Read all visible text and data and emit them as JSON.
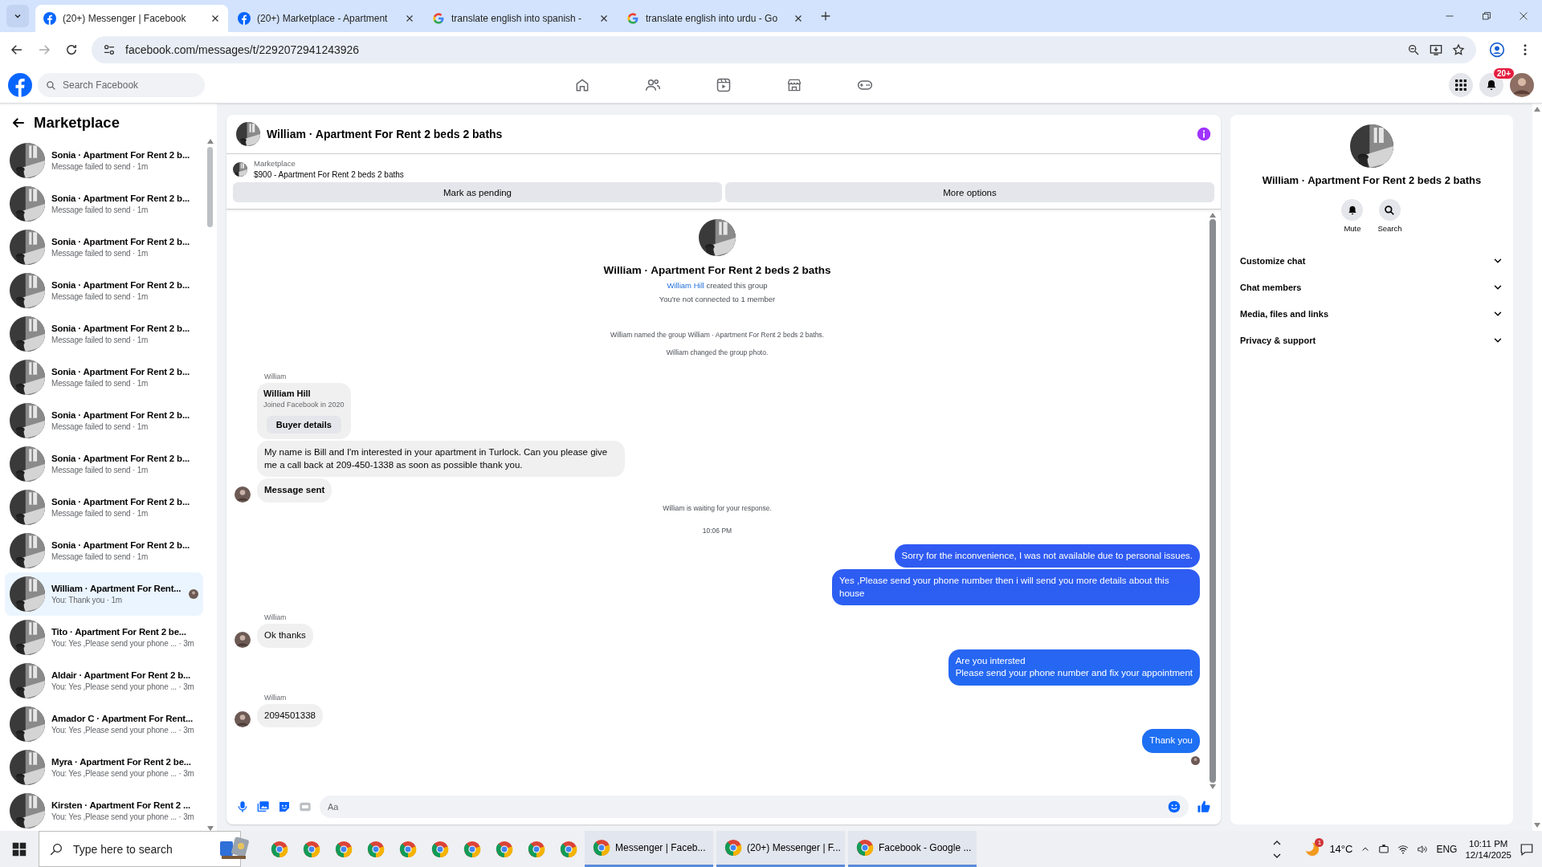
{
  "browser": {
    "tabs": [
      {
        "title": "(20+) Messenger | Facebook",
        "kind": "facebook",
        "selected": true
      },
      {
        "title": "(20+) Marketplace - Apartment",
        "kind": "facebook",
        "selected": false
      },
      {
        "title": "translate english into spanish -",
        "kind": "google",
        "selected": false
      },
      {
        "title": "translate english into urdu - Go",
        "kind": "google",
        "selected": false
      }
    ],
    "url": "facebook.com/messages/t/2292072941243926"
  },
  "facebook_header": {
    "search": {
      "placeholder": "Search Facebook"
    },
    "notification_badge": "20+"
  },
  "sidebar": {
    "title": "Marketplace",
    "conversations": [
      {
        "name": "Sonia · Apartment For Rent 2 b...",
        "preview": "Message failed to send · 1m",
        "selected": false,
        "seen": false
      },
      {
        "name": "Sonia · Apartment For Rent 2 b...",
        "preview": "Message failed to send · 1m",
        "selected": false,
        "seen": false
      },
      {
        "name": "Sonia · Apartment For Rent 2 b...",
        "preview": "Message failed to send · 1m",
        "selected": false,
        "seen": false
      },
      {
        "name": "Sonia · Apartment For Rent 2 b...",
        "preview": "Message failed to send · 1m",
        "selected": false,
        "seen": false
      },
      {
        "name": "Sonia · Apartment For Rent 2 b...",
        "preview": "Message failed to send · 1m",
        "selected": false,
        "seen": false
      },
      {
        "name": "Sonia · Apartment For Rent 2 b...",
        "preview": "Message failed to send · 1m",
        "selected": false,
        "seen": false
      },
      {
        "name": "Sonia · Apartment For Rent 2 b...",
        "preview": "Message failed to send · 1m",
        "selected": false,
        "seen": false
      },
      {
        "name": "Sonia · Apartment For Rent 2 b...",
        "preview": "Message failed to send · 1m",
        "selected": false,
        "seen": false
      },
      {
        "name": "Sonia · Apartment For Rent 2 b...",
        "preview": "Message failed to send · 1m",
        "selected": false,
        "seen": false
      },
      {
        "name": "Sonia · Apartment For Rent 2 b...",
        "preview": "Message failed to send · 1m",
        "selected": false,
        "seen": false
      },
      {
        "name": "William · Apartment For Rent...",
        "preview": "You: Thank you · 1m",
        "selected": true,
        "seen": true
      },
      {
        "name": "Tito · Apartment For Rent 2 be...",
        "preview": "You: Yes ,Please send your phone ... · 3m",
        "selected": false,
        "seen": false
      },
      {
        "name": "Aldair · Apartment For Rent 2 b...",
        "preview": "You: Yes ,Please send your phone ... · 3m",
        "selected": false,
        "seen": false
      },
      {
        "name": "Amador C · Apartment For Rent...",
        "preview": "You: Yes ,Please send your phone ... · 3m",
        "selected": false,
        "seen": false
      },
      {
        "name": "Myra · Apartment For Rent 2 be...",
        "preview": "You: Yes ,Please send your phone ... · 3m",
        "selected": false,
        "seen": false
      },
      {
        "name": "Kirsten · Apartment For Rent 2 ...",
        "preview": "You: Yes ,Please send your phone ... · 3m",
        "selected": false,
        "seen": false
      }
    ]
  },
  "chat": {
    "title": "William · Apartment For Rent 2 beds 2 baths",
    "listing": {
      "label": "Marketplace",
      "title": "$900 - Apartment For Rent 2 beds 2 baths"
    },
    "buttons": [
      "Mark as pending",
      "More options"
    ],
    "intro": {
      "title": "William · Apartment For Rent 2 beds 2 baths",
      "creator": "William Hill",
      "created_text": "created this group",
      "connection": "You're not connected to 1 member"
    },
    "messages": [
      {
        "kind": "event",
        "text": "William named the group William · Apartment For Rent 2 beds 2 baths."
      },
      {
        "kind": "event",
        "text": "William changed the group photo."
      },
      {
        "kind": "sender",
        "text": "William"
      },
      {
        "kind": "profile_card",
        "name": "William Hill",
        "subtitle": "Joined Facebook in 2020",
        "button": "Buyer details"
      },
      {
        "kind": "incoming",
        "text": "My name is Bill and I'm interested in your apartment in Turlock. Can you please give me a call back at 209-450-1338 as soon as possible thank you.",
        "avatar": false
      },
      {
        "kind": "status",
        "text": "Message sent",
        "avatar": true
      },
      {
        "kind": "event",
        "text": "William is waiting for your response."
      },
      {
        "kind": "time",
        "text": "10:06 PM"
      },
      {
        "kind": "outgoing",
        "text": "Sorry for the inconvenience, I was not available due to personal issues."
      },
      {
        "kind": "outgoing",
        "text": "Yes ,Please send your phone number then i will send you more details about this house"
      },
      {
        "kind": "sender",
        "text": "William"
      },
      {
        "kind": "incoming",
        "text": "Ok thanks",
        "avatar": true
      },
      {
        "kind": "outgoing",
        "text": "Are you intersted\nPlease send your phone number and fix your appointment"
      },
      {
        "kind": "sender",
        "text": "William"
      },
      {
        "kind": "incoming",
        "text": "2094501338",
        "avatar": true
      },
      {
        "kind": "outgoing",
        "text": "Thank you",
        "seen": true
      }
    ],
    "composer": {
      "placeholder": "Aa"
    }
  },
  "details": {
    "title": "William · Apartment For Rent 2 beds 2 baths",
    "actions": [
      {
        "label": "Mute",
        "kind": "mute"
      },
      {
        "label": "Search",
        "kind": "search"
      }
    ],
    "sections": [
      {
        "label": "Customize chat",
        "expanded": false
      },
      {
        "label": "Chat members",
        "expanded": false
      },
      {
        "label": "Media, files and links",
        "expanded": false
      },
      {
        "label": "Privacy & support",
        "expanded": false
      }
    ]
  },
  "taskbar": {
    "search": {
      "placeholder": "Type here to search"
    },
    "apps": [
      {
        "kind": "chrome"
      },
      {
        "kind": "chrome"
      },
      {
        "kind": "chrome"
      },
      {
        "kind": "chrome"
      },
      {
        "kind": "chrome"
      },
      {
        "kind": "chrome"
      },
      {
        "kind": "chrome"
      },
      {
        "kind": "chrome"
      },
      {
        "kind": "chrome"
      },
      {
        "kind": "chrome"
      },
      {
        "kind": "chrome",
        "label": "Messenger | Faceb..."
      },
      {
        "kind": "chrome",
        "label": "(20+) Messenger | F..."
      },
      {
        "kind": "chrome",
        "label": "Facebook - Google ..."
      }
    ],
    "weather_badge": "1",
    "temperature": "14°C",
    "language": "ENG",
    "time": "10:11 PM",
    "date": "12/14/2025"
  }
}
